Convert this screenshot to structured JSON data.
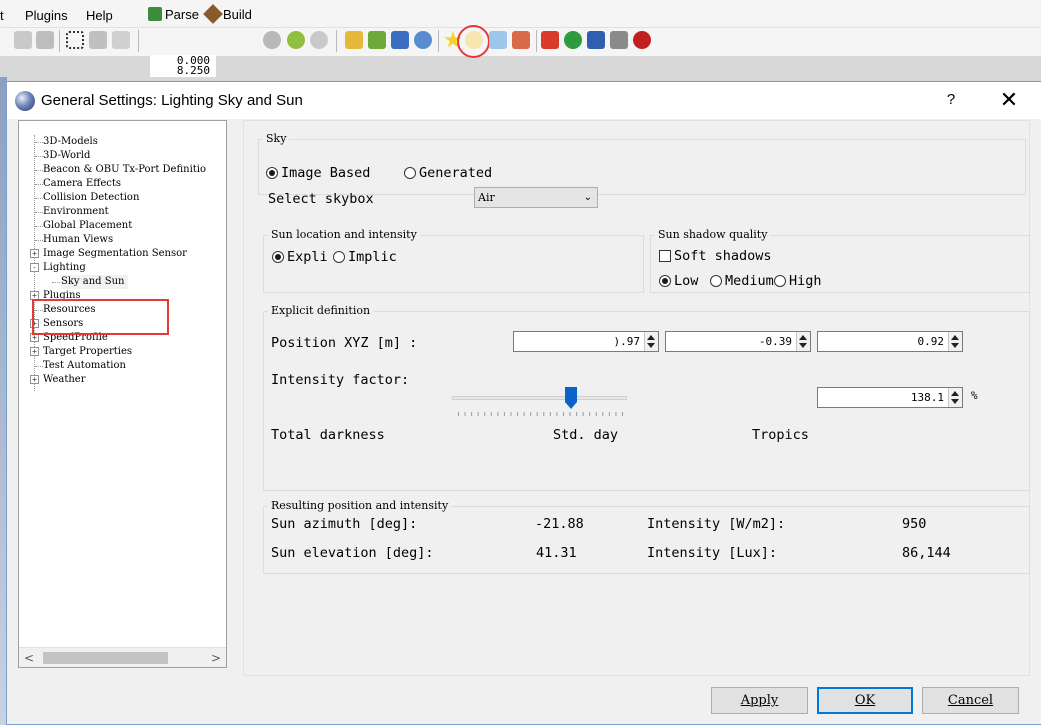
{
  "app": {
    "menu": [
      "t",
      "Plugins",
      "Help"
    ],
    "toolbar": {
      "parse_label": "Parse",
      "build_label": "Build"
    },
    "readout": [
      "0.000",
      "8.250"
    ]
  },
  "dialog": {
    "title": "General Settings: Lighting Sky and Sun",
    "help": "?",
    "close": "✕"
  },
  "tree": {
    "items": [
      {
        "label": "3D-Models",
        "expander": false
      },
      {
        "label": "3D-World",
        "expander": false
      },
      {
        "label": "Beacon & OBU Tx-Port Definitio",
        "expander": false
      },
      {
        "label": "Camera Effects",
        "expander": false
      },
      {
        "label": "Collision Detection",
        "expander": false
      },
      {
        "label": "Environment",
        "expander": false
      },
      {
        "label": "Global Placement",
        "expander": false
      },
      {
        "label": "Human Views",
        "expander": false
      },
      {
        "label": "Image Segmentation Sensor",
        "expander": "+"
      },
      {
        "label": "Lighting",
        "expander": "-"
      },
      {
        "label": "Sky and Sun",
        "expander": false,
        "child": true,
        "selected": true
      },
      {
        "label": "Plugins",
        "expander": "+"
      },
      {
        "label": "Resources",
        "expander": false
      },
      {
        "label": "Sensors",
        "expander": "+"
      },
      {
        "label": "SpeedProfile",
        "expander": "+"
      },
      {
        "label": "Target Properties",
        "expander": "+"
      },
      {
        "label": "Test Automation",
        "expander": false
      },
      {
        "label": "Weather",
        "expander": "+"
      }
    ]
  },
  "sky": {
    "group_label": "Sky",
    "image_based_label": "Image Based",
    "generated_label": "Generated",
    "selected_mode": "image_based",
    "skybox_label": "Select skybox",
    "skybox_value": "Air"
  },
  "sun_location": {
    "group_label": "Sun location and intensity",
    "explicit_label": "Expli",
    "implicit_label": "Implic",
    "selected": "explicit"
  },
  "sun_shadow": {
    "group_label": "Sun shadow quality",
    "soft_shadows_label": "Soft shadows",
    "soft_shadows_checked": false,
    "low_label": "Low",
    "medium_label": "Medium",
    "high_label": "High",
    "selected": "low"
  },
  "explicit": {
    "group_label": "Explicit definition",
    "position_label": "Position XYZ [m] :",
    "position_x": ").97",
    "position_y": "-0.39",
    "position_z": "0.92",
    "intensity_label": "Intensity factor:",
    "intensity_value": "138.1",
    "intensity_unit": "%",
    "slider_level": 0.68,
    "scale_left": "Total darkness",
    "scale_mid": "Std. day",
    "scale_right": "Tropics"
  },
  "result": {
    "group_label": "Resulting position and intensity",
    "azimuth_label": "Sun azimuth [deg]:",
    "azimuth_value": "-21.88",
    "elevation_label": "Sun elevation [deg]:",
    "elevation_value": "41.31",
    "intensity_wm2_label": "Intensity [W/m2]:",
    "intensity_wm2_value": "950",
    "intensity_lux_label": "Intensity [Lux]:",
    "intensity_lux_value": "86,144"
  },
  "buttons": {
    "apply": "Apply",
    "ok": "OK",
    "cancel": "Cancel"
  }
}
